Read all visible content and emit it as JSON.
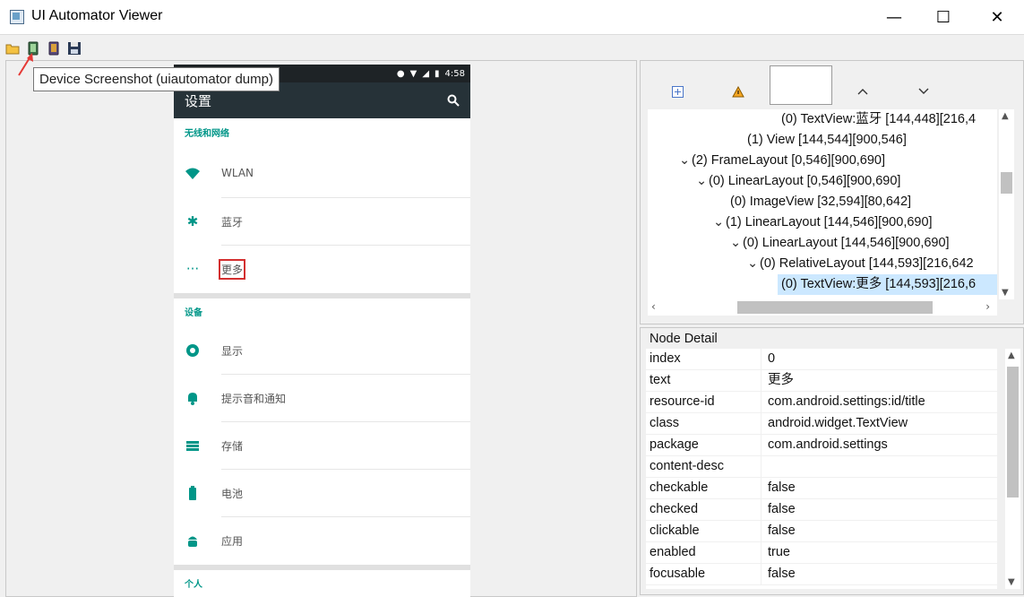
{
  "window": {
    "title": "UI Automator Viewer"
  },
  "toolbar": {
    "tooltip": "Device Screenshot (uiautomator dump)"
  },
  "device": {
    "time": "4:58",
    "appbar_title": "设置",
    "sections": [
      {
        "header": "无线和网络",
        "items": [
          {
            "icon": "wifi-icon",
            "label": "WLAN"
          },
          {
            "icon": "bluetooth-icon",
            "label": "蓝牙"
          },
          {
            "icon": "more-icon",
            "label": "更多",
            "highlighted": true
          }
        ]
      },
      {
        "header": "设备",
        "items": [
          {
            "icon": "display-icon",
            "label": "显示"
          },
          {
            "icon": "notification-icon",
            "label": "提示音和通知"
          },
          {
            "icon": "storage-icon",
            "label": "存储"
          },
          {
            "icon": "battery-icon",
            "label": "电池"
          },
          {
            "icon": "android-icon",
            "label": "应用"
          }
        ]
      },
      {
        "header": "个人",
        "items": []
      }
    ]
  },
  "hierarchy": {
    "rows": [
      {
        "text": "(0) TextView:蓝牙 [144,448][216,4",
        "caret": "",
        "depth": 7
      },
      {
        "text": "(1) View [144,544][900,546]",
        "caret": "",
        "depth": 5
      },
      {
        "text": "(2) FrameLayout [0,546][900,690]",
        "caret": "v",
        "depth": 2
      },
      {
        "text": "(0) LinearLayout [0,546][900,690]",
        "caret": "v",
        "depth": 3
      },
      {
        "text": "(0) ImageView [32,594][80,642]",
        "caret": "",
        "depth": 5
      },
      {
        "text": "(1) LinearLayout [144,546][900,690]",
        "caret": "v",
        "depth": 4
      },
      {
        "text": "(0) LinearLayout [144,546][900,690]",
        "caret": "v",
        "depth": 5
      },
      {
        "text": "(0) RelativeLayout [144,593][216,642",
        "caret": "v",
        "depth": 6
      },
      {
        "text": "(0) TextView:更多 [144,593][216,6",
        "caret": "",
        "depth": 7,
        "selected": true
      }
    ]
  },
  "node_detail": {
    "title": "Node Detail",
    "rows": [
      {
        "key": "index",
        "value": "0"
      },
      {
        "key": "text",
        "value": "更多"
      },
      {
        "key": "resource-id",
        "value": "com.android.settings:id/title"
      },
      {
        "key": "class",
        "value": "android.widget.TextView"
      },
      {
        "key": "package",
        "value": "com.android.settings"
      },
      {
        "key": "content-desc",
        "value": ""
      },
      {
        "key": "checkable",
        "value": "false"
      },
      {
        "key": "checked",
        "value": "false"
      },
      {
        "key": "clickable",
        "value": "false"
      },
      {
        "key": "enabled",
        "value": "true"
      },
      {
        "key": "focusable",
        "value": "false"
      }
    ]
  },
  "colors": {
    "accent": "#009688",
    "appbar": "#263238",
    "selection": "#cce8ff",
    "highlight_box": "#d32f2f"
  }
}
